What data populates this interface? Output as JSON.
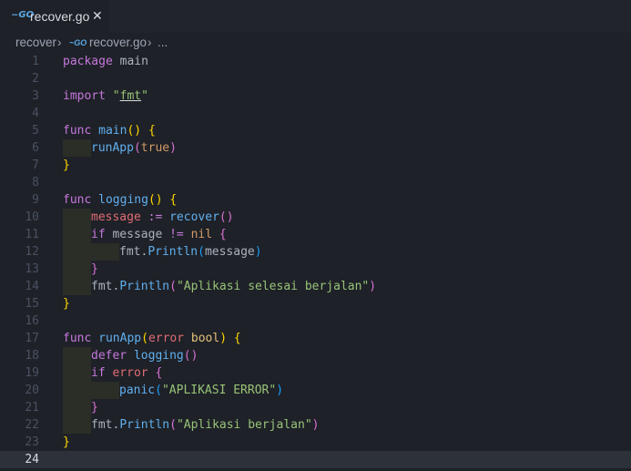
{
  "tab": {
    "icon": "go-file-icon",
    "label": "recover.go",
    "close": "✕"
  },
  "breadcrumb": {
    "folder": "recover",
    "sep1": "›",
    "file": "recover.go",
    "sep2": "›",
    "more": "..."
  },
  "editor": {
    "current_line": 24,
    "lines": [
      {
        "n": "1"
      },
      {
        "n": "2"
      },
      {
        "n": "3"
      },
      {
        "n": "4"
      },
      {
        "n": "5"
      },
      {
        "n": "6"
      },
      {
        "n": "7"
      },
      {
        "n": "8"
      },
      {
        "n": "9"
      },
      {
        "n": "10"
      },
      {
        "n": "11"
      },
      {
        "n": "12"
      },
      {
        "n": "13"
      },
      {
        "n": "14"
      },
      {
        "n": "15"
      },
      {
        "n": "16"
      },
      {
        "n": "17"
      },
      {
        "n": "18"
      },
      {
        "n": "19"
      },
      {
        "n": "20"
      },
      {
        "n": "21"
      },
      {
        "n": "22"
      },
      {
        "n": "23"
      },
      {
        "n": "24"
      }
    ],
    "tokens": {
      "package": "package",
      "main_pkg": "main",
      "import": "import",
      "fmt_q1": "\"",
      "fmt": "fmt",
      "fmt_q2": "\"",
      "func": "func",
      "main_fn": "main",
      "paren_pair": "()",
      "brace_open": "{",
      "brace_close": "}",
      "runApp": "runApp",
      "true": "true",
      "logging": "logging",
      "message": "message",
      "assign": ":=",
      "recover": "recover",
      "if": "if",
      "neq": "!=",
      "nil": "nil",
      "fmt_obj": "fmt",
      "dot": ".",
      "Println": "Println",
      "str_selesai": "\"Aplikasi selesai berjalan\"",
      "error": "error",
      "bool": "bool",
      "defer": "defer",
      "panic": "panic",
      "str_error": "\"APLIKASI ERROR\"",
      "str_berjalan": "\"Aplikasi berjalan\""
    }
  },
  "colors": {
    "background": "#1e2127",
    "keyword": "#c678dd",
    "function": "#61afef",
    "string": "#98c379",
    "variable": "#e06c75",
    "type": "#e5c07b"
  }
}
